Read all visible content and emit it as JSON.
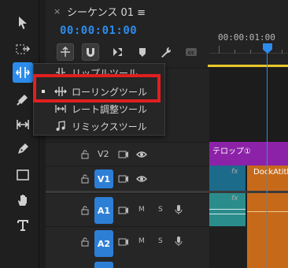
{
  "tools": [
    {
      "name": "selection-tool"
    },
    {
      "name": "track-select-tool"
    },
    {
      "name": "ripple-edit-tool",
      "active": true
    },
    {
      "name": "razor-tool"
    },
    {
      "name": "slip-tool"
    },
    {
      "name": "pen-tool"
    },
    {
      "name": "rectangle-tool"
    },
    {
      "name": "hand-tool"
    },
    {
      "name": "type-tool"
    }
  ],
  "panel": {
    "close_glyph": "×",
    "title": "シーケンス 01 ≡",
    "timecode": "00:00:01:00",
    "ruler_time": "00:00:01:00"
  },
  "menu": {
    "items": [
      {
        "label": "リップルツール",
        "selected": false
      },
      {
        "label": "ローリングツール",
        "selected": true
      },
      {
        "label": "レート調整ツール",
        "selected": false
      },
      {
        "label": "リミックスツール",
        "selected": false
      }
    ]
  },
  "tracks": {
    "v2": {
      "label": "V2"
    },
    "v1": {
      "label": "V1"
    },
    "a1": {
      "label": "A1",
      "m": "M",
      "s": "S"
    },
    "a2": {
      "label": "A2",
      "m": "M",
      "s": "S"
    }
  },
  "clips": {
    "title_clip": "テロップ①",
    "video_clip": "DockAtitla",
    "fx": "fx"
  },
  "colors": {
    "accent": "#2d8ceb",
    "title_clip": "#8c22a8",
    "video_clip": "#1c6b8a",
    "video_clip_2": "#c66a1a",
    "audio_clip": "#2b8c8c",
    "highlight": "#e01f1f"
  }
}
